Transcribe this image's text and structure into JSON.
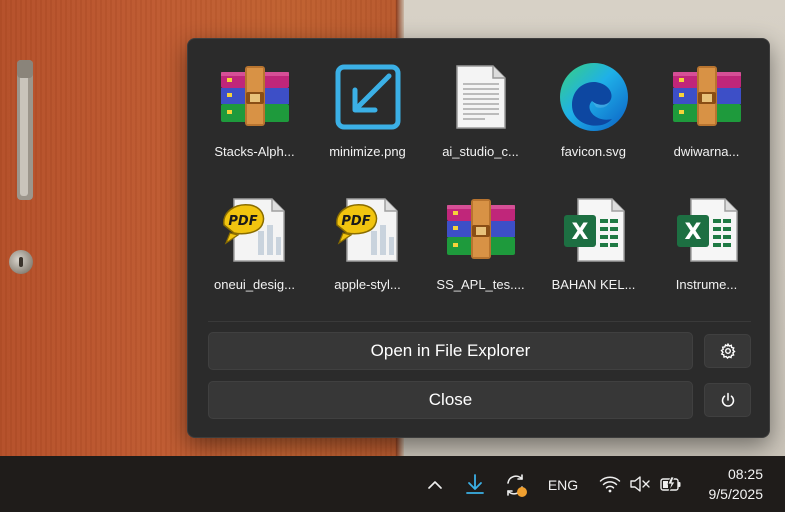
{
  "flyout": {
    "files": [
      {
        "name": "Stacks-Alph...",
        "icon": "winrar-archive-icon"
      },
      {
        "name": "minimize.png",
        "icon": "minimize-image-icon"
      },
      {
        "name": "ai_studio_c...",
        "icon": "text-file-icon"
      },
      {
        "name": "favicon.svg",
        "icon": "edge-icon"
      },
      {
        "name": "dwiwarna...",
        "icon": "winrar-archive-icon"
      },
      {
        "name": "oneui_desig...",
        "icon": "pdf-file-icon"
      },
      {
        "name": "apple-styl...",
        "icon": "pdf-file-icon"
      },
      {
        "name": "SS_APL_tes....",
        "icon": "winrar-archive-icon"
      },
      {
        "name": "BAHAN KEL...",
        "icon": "excel-file-icon"
      },
      {
        "name": "Instrume...",
        "icon": "excel-file-icon"
      }
    ],
    "open_label": "Open in File Explorer",
    "close_label": "Close"
  },
  "taskbar": {
    "language": "ENG",
    "time": "08:25",
    "date": "9/5/2025"
  },
  "colors": {
    "panel": "#2b2b2b",
    "button": "#373737",
    "download_accent": "#3bb0e6",
    "update_badge": "#f0a030"
  }
}
